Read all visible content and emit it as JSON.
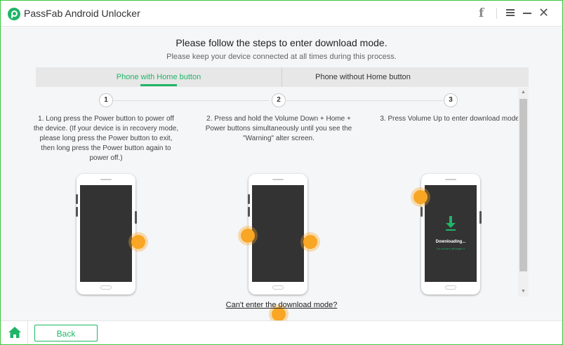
{
  "app": {
    "title": "PassFab Android Unlocker",
    "accent_color": "#1fb567",
    "titlebar_icons": [
      "facebook-icon",
      "menu-icon",
      "minimize-icon",
      "close-icon"
    ]
  },
  "header": {
    "title": "Please follow the steps to enter download mode.",
    "subtitle": "Please keep your device connected at all times during this process."
  },
  "tabs": [
    {
      "label": "Phone with Home button",
      "active": true
    },
    {
      "label": "Phone without Home button",
      "active": false
    }
  ],
  "steps": [
    {
      "number": "1",
      "text": "1. Long press the Power button to power off the device. (If your device is in recovery mode, please long press the Power button to exit, then long press the Power button again to power off.)"
    },
    {
      "number": "2",
      "text": "2. Press and hold the Volume Down + Home + Power buttons simultaneously until you see the \"Warning\" alter screen."
    },
    {
      "number": "3",
      "text": "3. Press Volume Up to enter download mode."
    }
  ],
  "phone_screen": {
    "downloading": "Downloading...",
    "warning": "Do not turn off target !!"
  },
  "help_link": "Can't enter the download mode?",
  "footer": {
    "back_label": "Back"
  }
}
